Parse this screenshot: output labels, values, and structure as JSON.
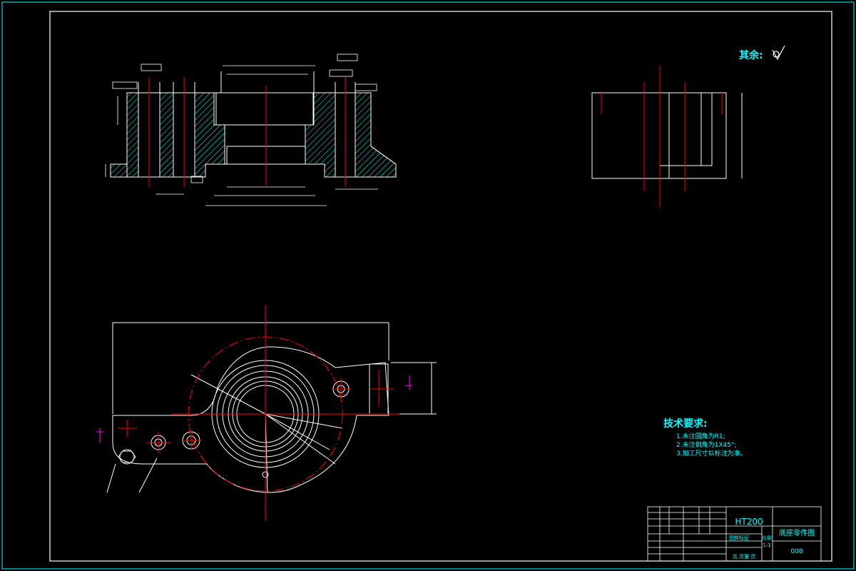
{
  "surface_note": {
    "label": "其余:",
    "symbol": "roughness-check-icon"
  },
  "tech_requirements": {
    "title": "技术要求:",
    "items": [
      "1.未注圆角为R1;",
      "2.未注倒角为1X45°;",
      "3.加工尺寸以标注为准。"
    ]
  },
  "title_block": {
    "material": "HT200",
    "part_name": "底座零件图",
    "drawing_no": "008",
    "scale_label": "比例",
    "scale": "1:1",
    "sheets": "共 页第 页",
    "stage_label": "图样标记"
  },
  "colors": {
    "border": "#00ffff",
    "line": "#ffffff",
    "center": "#ff0000",
    "hatch": "#00ffff",
    "text": "#00ffff",
    "marker": "#ff00ff"
  }
}
